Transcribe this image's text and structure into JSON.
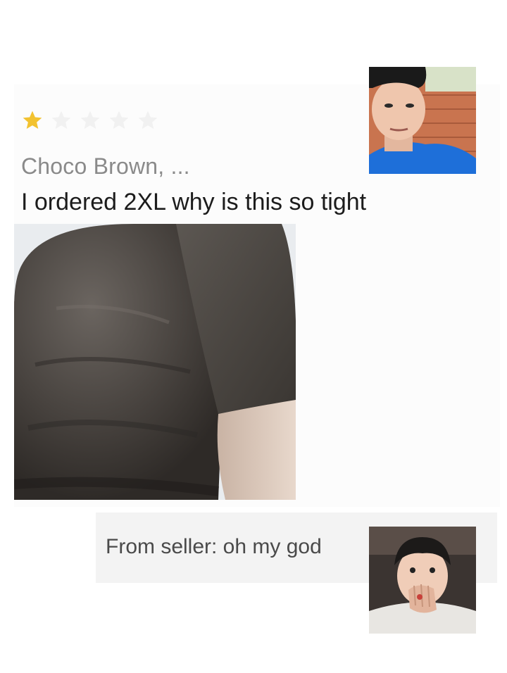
{
  "review": {
    "rating": 1,
    "rating_max": 5,
    "star_colors": {
      "filled": "#F2C230",
      "empty": "#F1F1F1"
    },
    "author": "Choco Brown, ...",
    "text": "I ordered 2XL why is this so tight",
    "photo_icon": "product-photo-tight-shirt"
  },
  "seller_reply": {
    "text": "From seller: oh my god"
  },
  "reaction_images": {
    "top": "reaction-face-blue-shirt",
    "bottom": "reaction-face-hand-over-mouth"
  }
}
